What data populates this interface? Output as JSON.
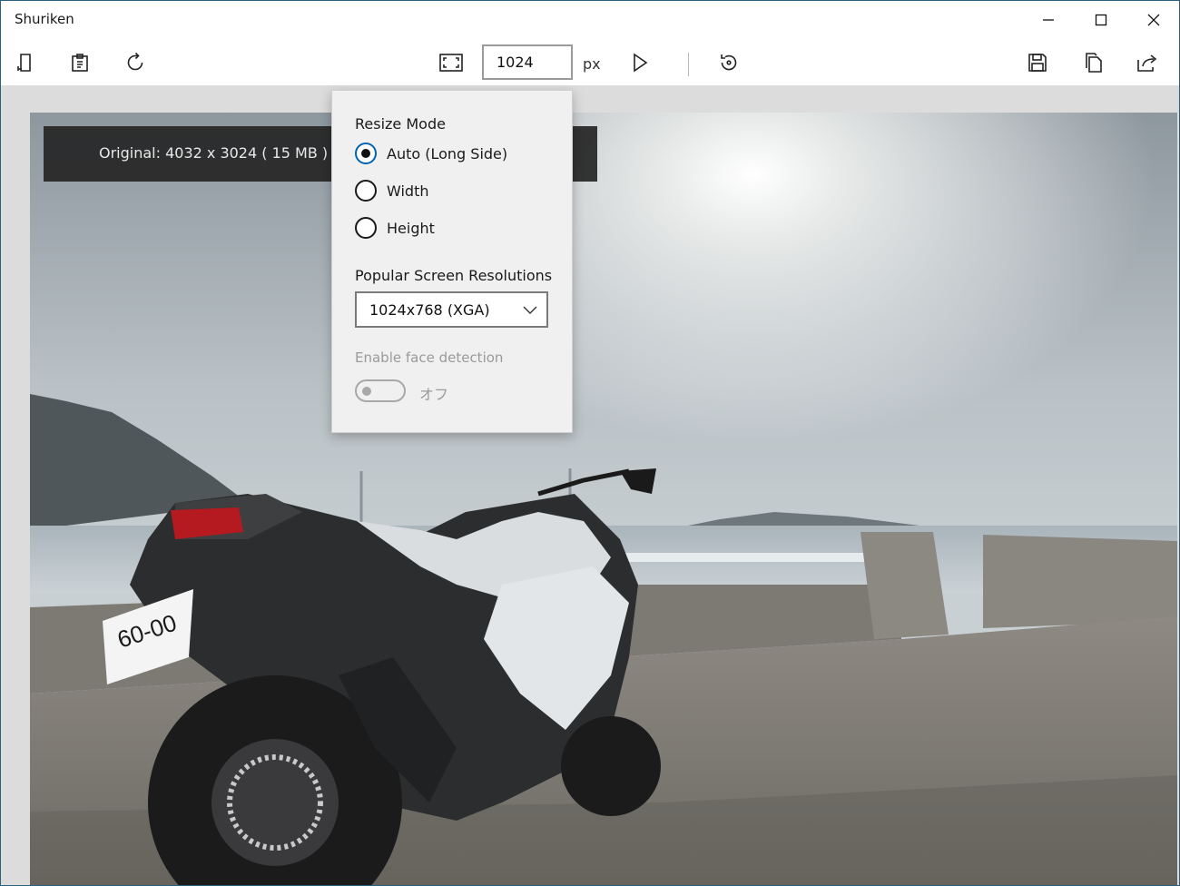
{
  "window": {
    "title": "Shuriken"
  },
  "toolbar": {
    "size_value": "1024",
    "unit": "px"
  },
  "info": {
    "original": "Original: 4032 x 3024 ( 15 MB ) –"
  },
  "flyout": {
    "resize_mode_heading": "Resize Mode",
    "modes": [
      {
        "label": "Auto (Long Side)",
        "selected": true
      },
      {
        "label": "Width",
        "selected": false
      },
      {
        "label": "Height",
        "selected": false
      }
    ],
    "popular_heading": "Popular Screen Resolutions",
    "resolution_selected": "1024x768 (XGA)",
    "face_detection_label": "Enable face detection",
    "face_detection_state": "オフ",
    "face_detection_on": false
  },
  "colors": {
    "accent": "#0063b1",
    "window_border": "#2b5f7e",
    "canvas_bg": "#dcdcdc"
  },
  "icons": [
    "new-window-icon",
    "paste-icon",
    "rotate-icon",
    "fit-screen-icon",
    "play-icon",
    "history-icon",
    "save-icon",
    "copy-icon",
    "share-icon",
    "minimize-icon",
    "maximize-icon",
    "close-icon",
    "chevron-down-icon"
  ]
}
